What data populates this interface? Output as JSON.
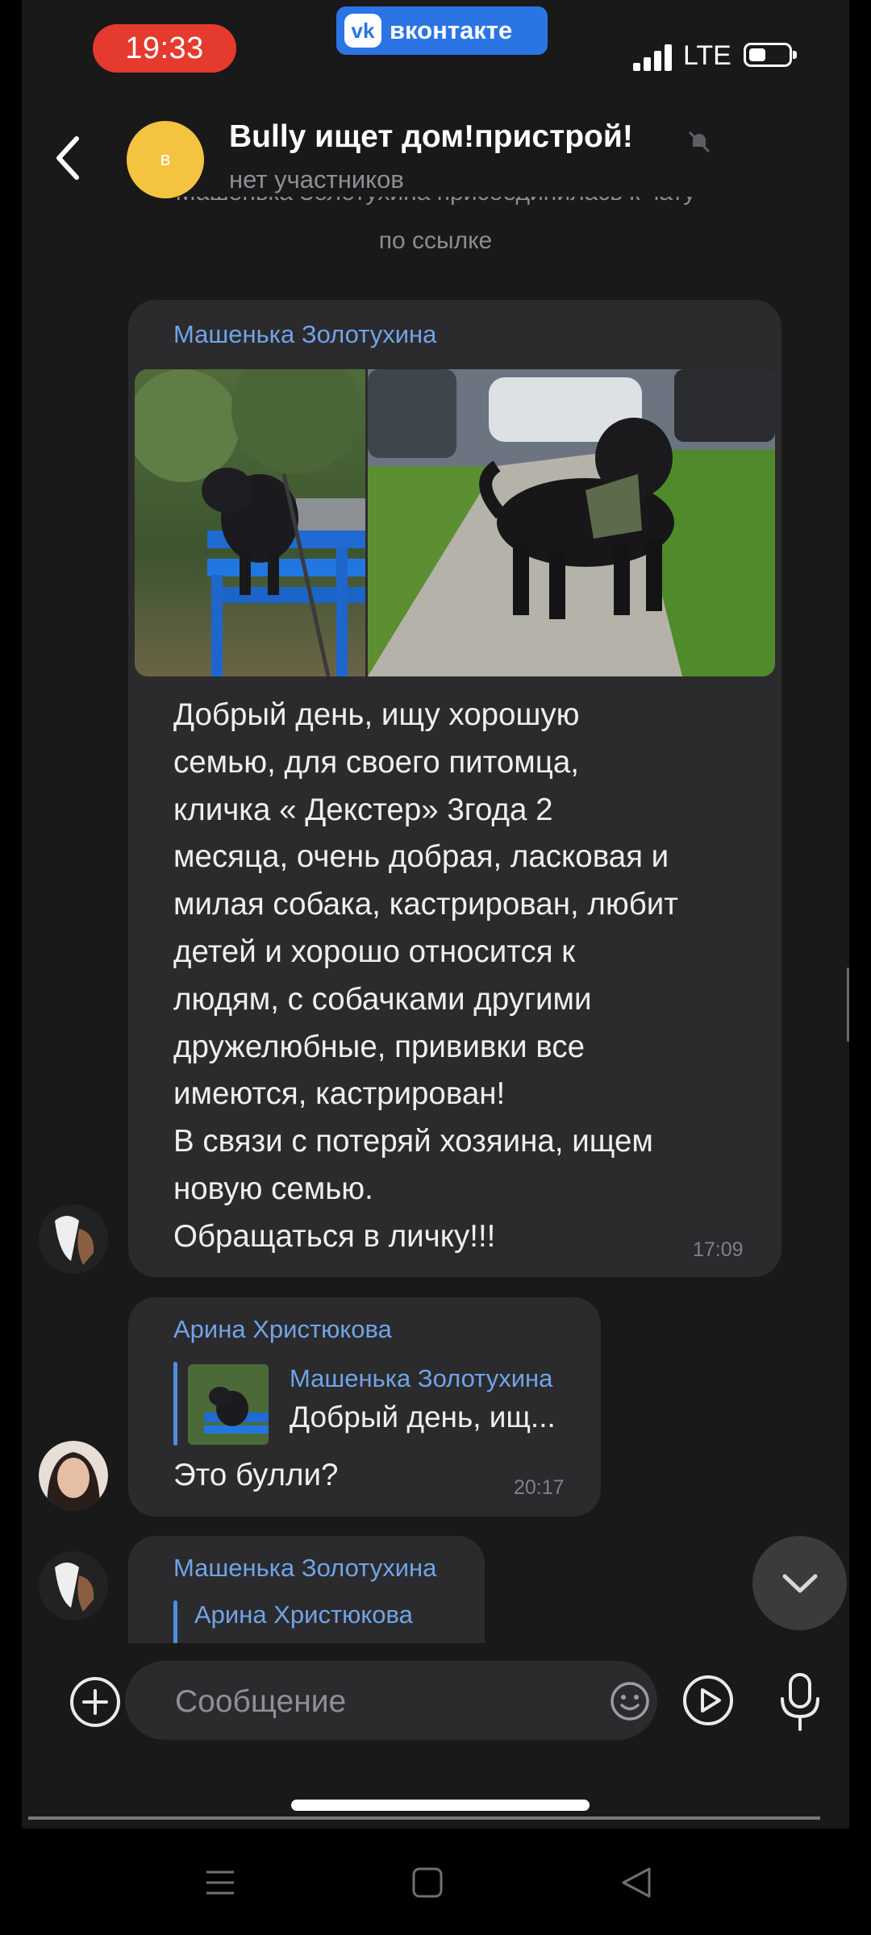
{
  "status_bar": {
    "time": "19:33",
    "app_pill_label": "вконтакте",
    "app_pill_logo": "vk",
    "network": "LTE",
    "colors": {
      "time_pill": "#e53a2e",
      "vk_pill": "#2a74e4"
    }
  },
  "header": {
    "avatar_letter": "в",
    "title": "Bully ищет дом!пристрой!",
    "subtitle": "нет участников",
    "muted_icon": "bell-muted-icon"
  },
  "system_notice": {
    "line1": "Машенька Золотухина присоединилась к чату",
    "line2": "по ссылке"
  },
  "messages": [
    {
      "sender": "Машенька Золотухина",
      "photos": [
        "dog-on-blue-bench",
        "dog-on-path-with-harness"
      ],
      "text": "Добрый день, ищу хорошую\nсемью, для своего питомца,\nкличка « Декстер» 3года 2\nмесяца, очень добрая, ласковая и\nмилая собака, кастрирован, любит\nдетей и хорошо относится к\nлюдям, с собачками другими\nдружелюбные, прививки все\nимеются, кастрирован!\nВ связи с потеряй хозяина, ищем\nновую семью.\nОбращаться в личку!!!",
      "time": "17:09"
    },
    {
      "sender": "Арина Христюкова",
      "reply": {
        "author": "Машенька Золотухина",
        "preview": "Добрый день, ищ..."
      },
      "text": "Это булли?",
      "time": "20:17"
    },
    {
      "sender": "Машенька Золотухина",
      "reply": {
        "author": "Арина Христюкова"
      }
    }
  ],
  "composer": {
    "placeholder": "Сообщение",
    "icons": [
      "plus-circle-icon",
      "emoji-icon",
      "video-message-icon",
      "microphone-icon"
    ]
  },
  "accent_color": "#71a3e8"
}
